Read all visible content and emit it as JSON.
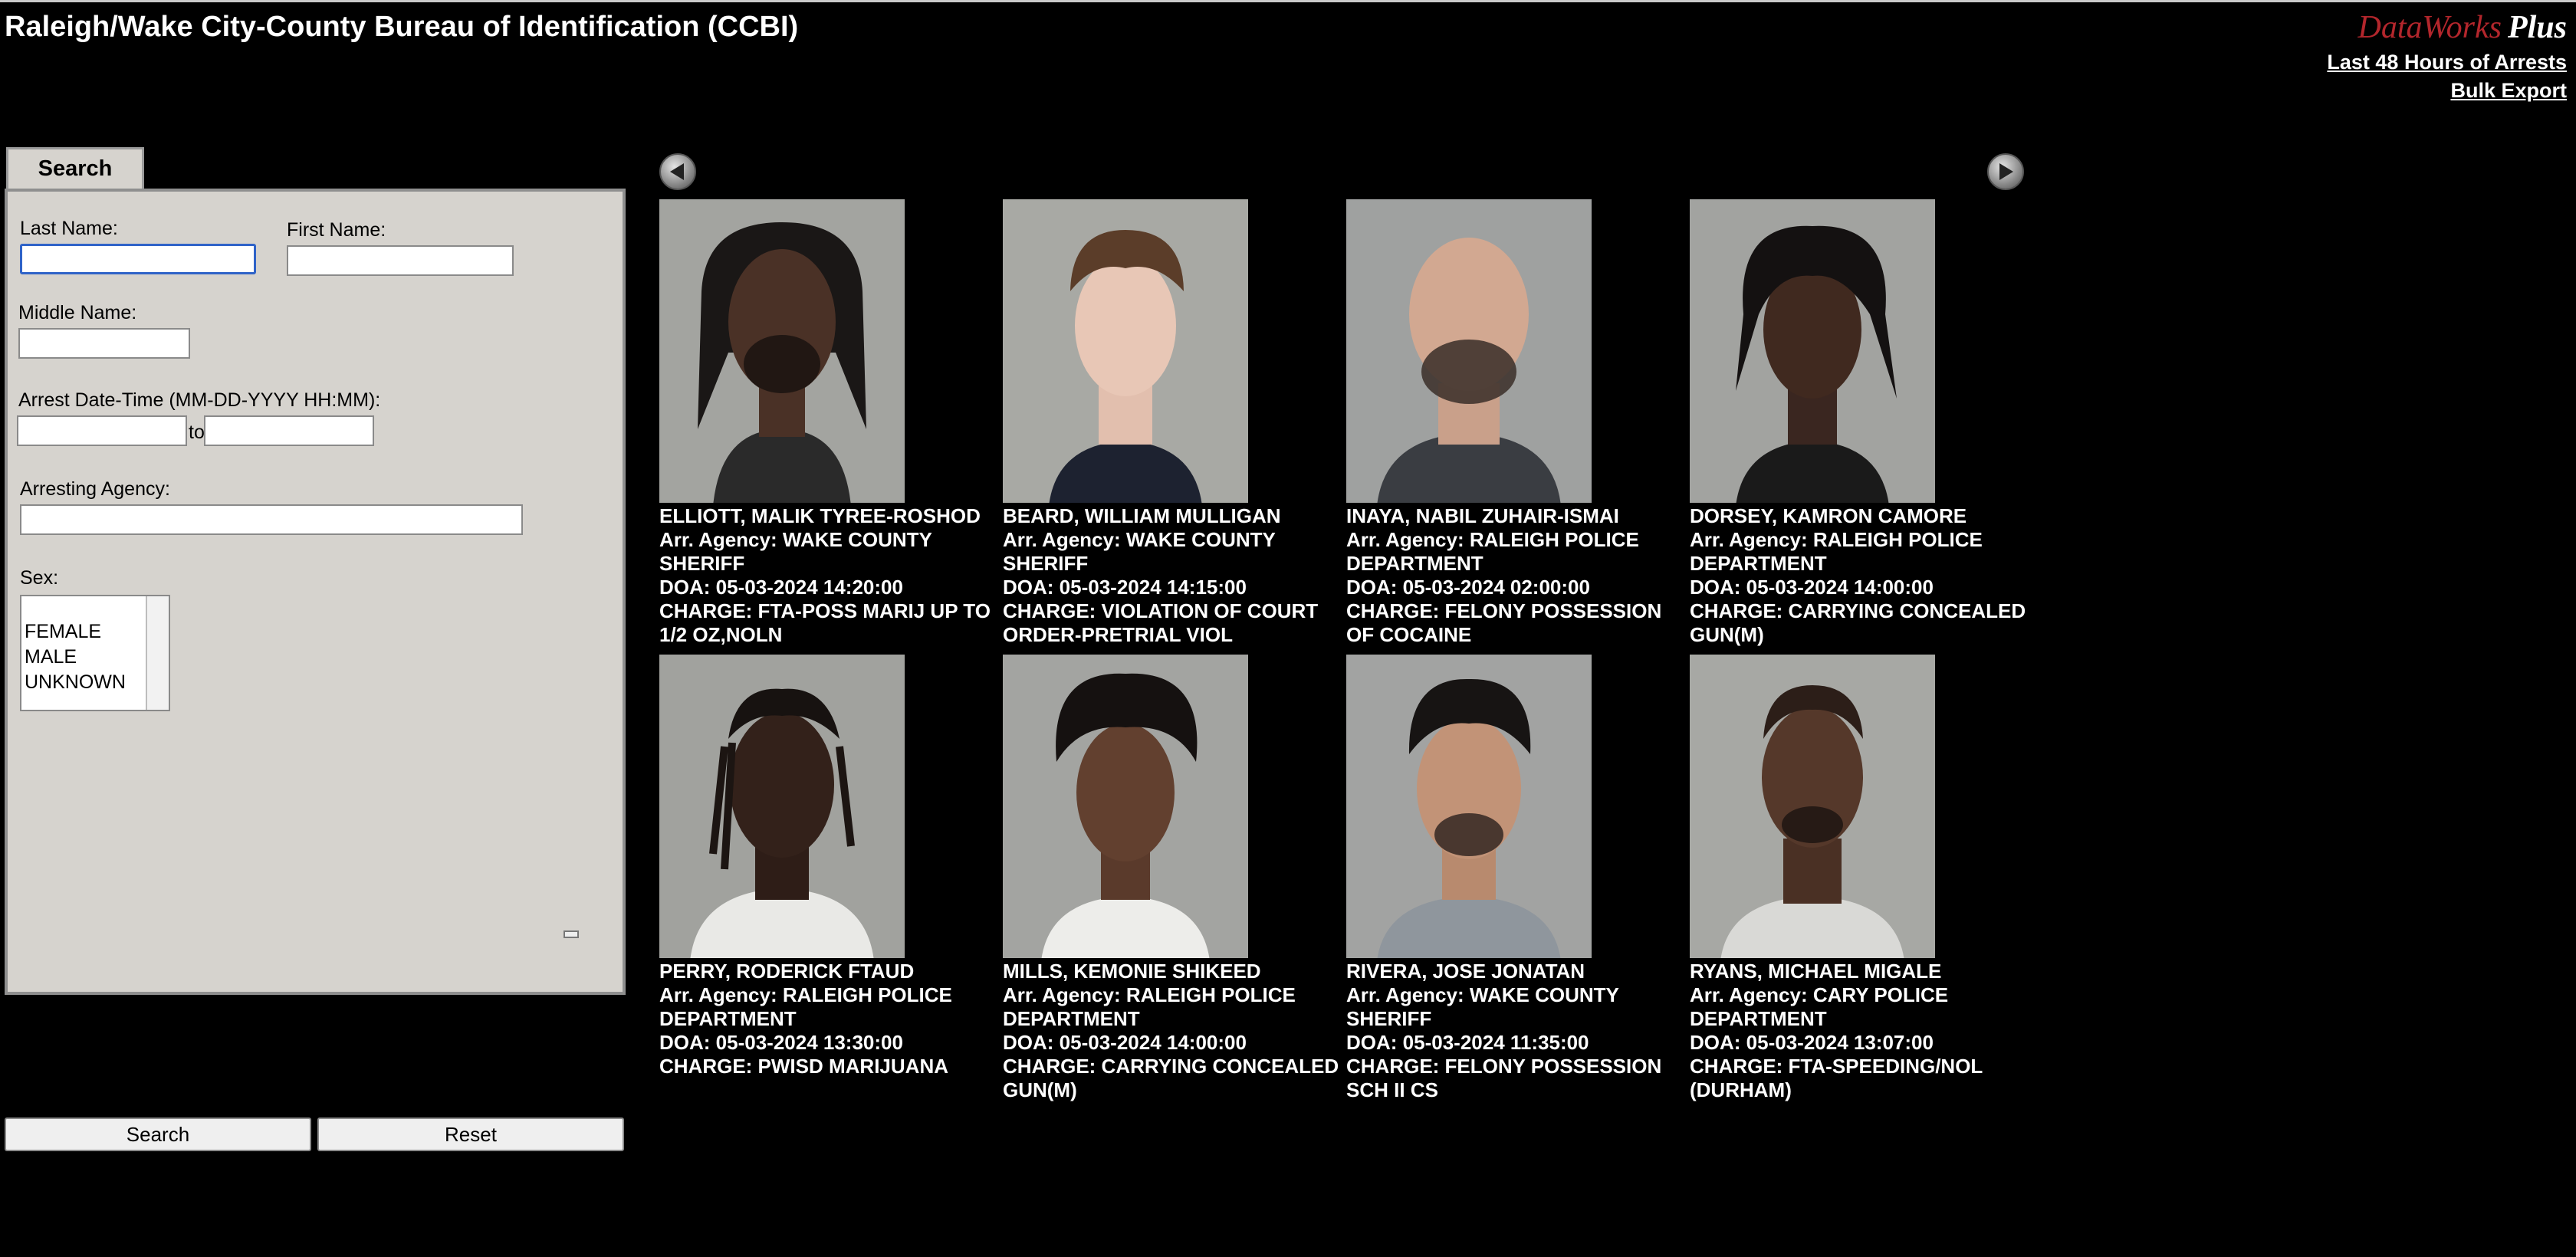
{
  "header": {
    "title": "Raleigh/Wake City-County Bureau of Identification (CCBI)",
    "logo_main": "DataWorks",
    "logo_plus": "Plus",
    "link_arrests": "Last 48 Hours of Arrests",
    "link_export": "Bulk Export"
  },
  "search": {
    "tab_label": "Search",
    "last_name_label": "Last Name:",
    "first_name_label": "First Name:",
    "middle_name_label": "Middle Name:",
    "arrest_date_label": "Arrest Date-Time (MM-DD-YYYY HH:MM):",
    "to_label": "to",
    "agency_label": "Arresting Agency:",
    "sex_label": "Sex:",
    "sex_options": [
      "FEMALE",
      "MALE",
      "UNKNOWN"
    ],
    "search_button": "Search",
    "reset_button": "Reset",
    "values": {
      "last_name": "",
      "first_name": "",
      "middle_name": "",
      "date_from": "",
      "date_to": "",
      "agency": ""
    }
  },
  "icons": {
    "prev": "arrow-left-icon",
    "next": "arrow-right-icon"
  },
  "arrests": [
    {
      "name": "ELLIOTT, MALIK TYREE-ROSHOD",
      "agency": "Arr. Agency: WAKE COUNTY SHERIFF",
      "doa": "DOA: 05-03-2024 14:20:00",
      "charge": "CHARGE: FTA-POSS MARIJ UP TO 1/2 OZ,NOLN"
    },
    {
      "name": "BEARD, WILLIAM MULLIGAN",
      "agency": "Arr. Agency: WAKE COUNTY SHERIFF",
      "doa": "DOA: 05-03-2024 14:15:00",
      "charge": "CHARGE: VIOLATION OF COURT ORDER-PRETRIAL VIOL"
    },
    {
      "name": "INAYA, NABIL ZUHAIR-ISMAI",
      "agency": "Arr. Agency: RALEIGH POLICE DEPARTMENT",
      "doa": "DOA: 05-03-2024 02:00:00",
      "charge": "CHARGE: FELONY POSSESSION OF COCAINE"
    },
    {
      "name": "DORSEY, KAMRON CAMORE",
      "agency": "Arr. Agency: RALEIGH POLICE DEPARTMENT",
      "doa": "DOA: 05-03-2024 14:00:00",
      "charge": "CHARGE: CARRYING CONCEALED GUN(M)"
    },
    {
      "name": "PERRY, RODERICK FTAUD",
      "agency": "Arr. Agency: RALEIGH POLICE DEPARTMENT",
      "doa": "DOA: 05-03-2024 13:30:00",
      "charge": "CHARGE: PWISD MARIJUANA"
    },
    {
      "name": "MILLS, KEMONIE SHIKEED",
      "agency": "Arr. Agency: RALEIGH POLICE DEPARTMENT",
      "doa": "DOA: 05-03-2024 14:00:00",
      "charge": "CHARGE: CARRYING CONCEALED GUN(M)"
    },
    {
      "name": "RIVERA, JOSE JONATAN",
      "agency": "Arr. Agency: WAKE COUNTY SHERIFF",
      "doa": "DOA: 05-03-2024 11:35:00",
      "charge": "CHARGE: FELONY POSSESSION SCH II CS"
    },
    {
      "name": "RYANS, MICHAEL MIGALE",
      "agency": "Arr. Agency: CARY POLICE DEPARTMENT",
      "doa": "DOA: 05-03-2024 13:07:00",
      "charge": "CHARGE: FTA-SPEEDING/NOL (DURHAM)"
    }
  ]
}
